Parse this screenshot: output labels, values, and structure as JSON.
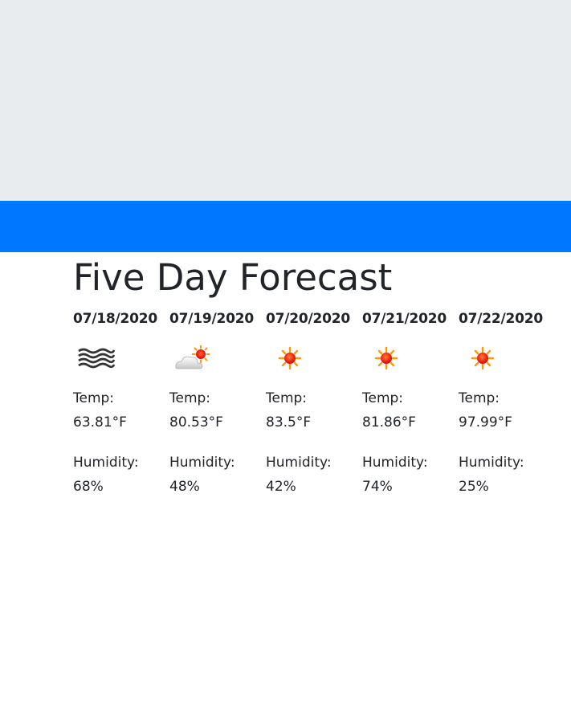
{
  "header": {
    "title": "Five Day Forecast"
  },
  "colors": {
    "jumbotron": "#e9ecef",
    "accent_bar": "#0077ff",
    "text": "#212529"
  },
  "forecast": [
    {
      "date": "07/18/2020",
      "icon": "mist-icon",
      "temp_label": "Temp:",
      "temp": "63.81°F",
      "humidity_label": "Humidity:",
      "humidity": "68%"
    },
    {
      "date": "07/19/2020",
      "icon": "partly-cloudy-icon",
      "temp_label": "Temp:",
      "temp": "80.53°F",
      "humidity_label": "Humidity:",
      "humidity": "48%"
    },
    {
      "date": "07/20/2020",
      "icon": "sun-icon",
      "temp_label": "Temp:",
      "temp": "83.5°F",
      "humidity_label": "Humidity:",
      "humidity": "42%"
    },
    {
      "date": "07/21/2020",
      "icon": "sun-icon",
      "temp_label": "Temp:",
      "temp": "81.86°F",
      "humidity_label": "Humidity:",
      "humidity": "74%"
    },
    {
      "date": "07/22/2020",
      "icon": "sun-icon",
      "temp_label": "Temp:",
      "temp": "97.99°F",
      "humidity_label": "Humidity:",
      "humidity": "25%"
    }
  ]
}
